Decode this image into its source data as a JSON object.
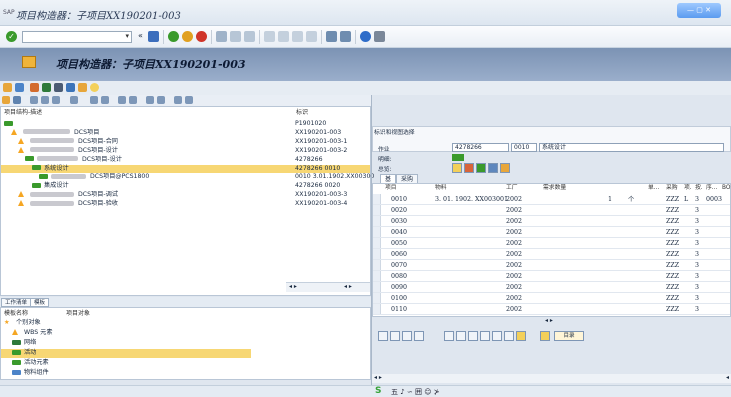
{
  "window": {
    "title": "项目构造器：子项目XX190201-003",
    "sap_prefix": "SAP",
    "win_buttons": "— ▢ ✕"
  },
  "toolbar": {
    "command_value": "",
    "back_label": "«"
  },
  "header": {
    "title": "项目构造器：子项目XX190201-003"
  },
  "tree": {
    "col_struct": "项目结构-描述",
    "col_id": "标识",
    "rows": [
      {
        "indent": 0,
        "icon": "grn",
        "text": "",
        "suffix": "",
        "id": "P1901020"
      },
      {
        "indent": 1,
        "icon": "tri",
        "text": "",
        "suffix": "DCS项目",
        "id": "XX190201-003"
      },
      {
        "indent": 2,
        "icon": "tri",
        "text": "",
        "suffix": "DCS项目-合同",
        "id": "XX190201-003-1"
      },
      {
        "indent": 2,
        "icon": "tri",
        "text": "",
        "suffix": "DCS项目-设计",
        "id": "XX190201-003-2"
      },
      {
        "indent": 3,
        "icon": "grn",
        "text": "",
        "suffix": "DCS项目-设计",
        "id": "4278266"
      },
      {
        "indent": 4,
        "icon": "grn",
        "text": "系统设计",
        "suffix": "",
        "id": "4278266 0010",
        "selected": true
      },
      {
        "indent": 5,
        "icon": "grn",
        "text": "",
        "suffix": "DCS项目@PCS1800",
        "id": "0010 3.01.1902.XX00300"
      },
      {
        "indent": 4,
        "icon": "grn",
        "text": "集成设计",
        "suffix": "",
        "id": "4278266 0020"
      },
      {
        "indent": 2,
        "icon": "tri",
        "text": "",
        "suffix": "DCS项目-调试",
        "id": "XX190201-003-3"
      },
      {
        "indent": 2,
        "icon": "tri",
        "text": "",
        "suffix": "DCS项目-验收",
        "id": "XX190201-003-4"
      }
    ]
  },
  "bottom_left": {
    "tabs": [
      "工作清单",
      "模板"
    ],
    "col_name": "模板名称",
    "col_obj": "项目对象",
    "rows": [
      {
        "indent": 0,
        "icon": "star",
        "text": "个别对象"
      },
      {
        "indent": 1,
        "icon": "tri",
        "text": "WBS 元素"
      },
      {
        "indent": 1,
        "icon": "net",
        "text": "网络"
      },
      {
        "indent": 1,
        "icon": "grn",
        "text": "活动",
        "selected": true
      },
      {
        "indent": 1,
        "icon": "grn",
        "text": "活动元素"
      },
      {
        "indent": 1,
        "icon": "mat",
        "text": "物料组件"
      }
    ]
  },
  "right": {
    "section_title": "标识和视图选择",
    "op_label": "作业",
    "op_number": "4278266",
    "op_item": "0010",
    "op_desc": "系统设计",
    "detail_label": "明细:",
    "overview_label": "总览:",
    "tabs": [
      "基",
      "采购"
    ],
    "columns": [
      "项目",
      "物料",
      "工厂",
      "需求数量",
      "单...",
      "采购",
      "项.",
      "按.",
      "序...",
      "BO"
    ],
    "rows": [
      {
        "item": "0010",
        "material": "3. 01. 1902. XX003001",
        "plant": "2002",
        "qty": "1",
        "unit": "个",
        "grp": "ZZZ",
        "l": "L",
        "n": "3",
        "s": "0003"
      },
      {
        "item": "0020",
        "material": "",
        "plant": "2002",
        "qty": "",
        "unit": "",
        "grp": "ZZZ",
        "l": "",
        "n": "3",
        "s": ""
      },
      {
        "item": "0030",
        "material": "",
        "plant": "2002",
        "qty": "",
        "unit": "",
        "grp": "ZZZ",
        "l": "",
        "n": "3",
        "s": ""
      },
      {
        "item": "0040",
        "material": "",
        "plant": "2002",
        "qty": "",
        "unit": "",
        "grp": "ZZZ",
        "l": "",
        "n": "3",
        "s": ""
      },
      {
        "item": "0050",
        "material": "",
        "plant": "2002",
        "qty": "",
        "unit": "",
        "grp": "ZZZ",
        "l": "",
        "n": "3",
        "s": ""
      },
      {
        "item": "0060",
        "material": "",
        "plant": "2002",
        "qty": "",
        "unit": "",
        "grp": "ZZZ",
        "l": "",
        "n": "3",
        "s": ""
      },
      {
        "item": "0070",
        "material": "",
        "plant": "2002",
        "qty": "",
        "unit": "",
        "grp": "ZZZ",
        "l": "",
        "n": "3",
        "s": ""
      },
      {
        "item": "0080",
        "material": "",
        "plant": "2002",
        "qty": "",
        "unit": "",
        "grp": "ZZZ",
        "l": "",
        "n": "3",
        "s": ""
      },
      {
        "item": "0090",
        "material": "",
        "plant": "2002",
        "qty": "",
        "unit": "",
        "grp": "ZZZ",
        "l": "",
        "n": "3",
        "s": ""
      },
      {
        "item": "0100",
        "material": "",
        "plant": "2002",
        "qty": "",
        "unit": "",
        "grp": "ZZZ",
        "l": "",
        "n": "3",
        "s": ""
      },
      {
        "item": "0110",
        "material": "",
        "plant": "2002",
        "qty": "",
        "unit": "",
        "grp": "ZZZ",
        "l": "",
        "n": "3",
        "s": ""
      }
    ],
    "dir_button": "目录"
  },
  "status": {
    "brand": "S",
    "text": "五 ♪ ∽ 囲 ☺ ⊁"
  },
  "colors": {
    "header_band": "#8fa4c2",
    "selection": "#f7d774",
    "green": "#3a9a2c",
    "orange": "#f5a623"
  }
}
